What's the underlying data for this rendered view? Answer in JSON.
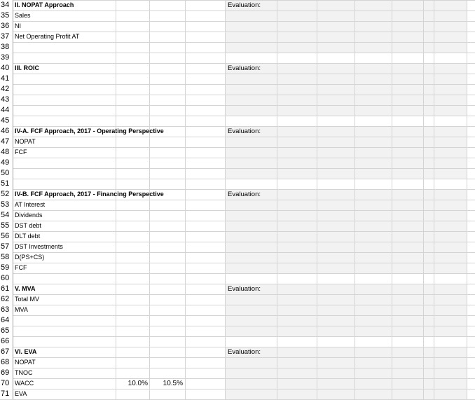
{
  "spreadsheet": {
    "row_numbers": [
      "34",
      "35",
      "36",
      "37",
      "38",
      "39",
      "40",
      "41",
      "42",
      "43",
      "44",
      "45",
      "46",
      "47",
      "48",
      "49",
      "50",
      "51",
      "52",
      "53",
      "54",
      "55",
      "56",
      "57",
      "58",
      "59",
      "60",
      "61",
      "62",
      "63",
      "64",
      "65",
      "66",
      "67",
      "68",
      "69",
      "70",
      "71"
    ],
    "rows": {
      "r34": {
        "label": "II. NOPAT Approach",
        "bold": true
      },
      "r35": {
        "label": "Sales"
      },
      "r36": {
        "label": "NI"
      },
      "r37": {
        "label": "Net Operating Profit AT"
      },
      "r40": {
        "label": "III. ROIC",
        "bold": true
      },
      "r46": {
        "label": "IV-A. FCF Approach, 2017 - Operating Perspective",
        "bold": true
      },
      "r47": {
        "label": "NOPAT"
      },
      "r48": {
        "label": "FCF"
      },
      "r52": {
        "label": "IV-B. FCF Approach, 2017 - Financing Perspective",
        "bold": true
      },
      "r53": {
        "label": "AT Interest"
      },
      "r54": {
        "label": "Dividends"
      },
      "r55": {
        "label": "DST debt"
      },
      "r56": {
        "label": "DLT debt"
      },
      "r57": {
        "label": "DST Investments"
      },
      "r58": {
        "label": "D(PS+CS)"
      },
      "r59": {
        "label": "FCF"
      },
      "r61": {
        "label": "V. MVA",
        "bold": true
      },
      "r62": {
        "label": "Total MV"
      },
      "r63": {
        "label": "MVA"
      },
      "r67": {
        "label": "VI. EVA",
        "bold": true
      },
      "r68": {
        "label": "NOPAT"
      },
      "r69": {
        "label": "TNOC"
      },
      "r70": {
        "label": "WACC",
        "v1": "10.0%",
        "v2": "10.5%"
      },
      "r71": {
        "label": "EVA"
      }
    },
    "evaluation_label": "Evaluation:"
  }
}
